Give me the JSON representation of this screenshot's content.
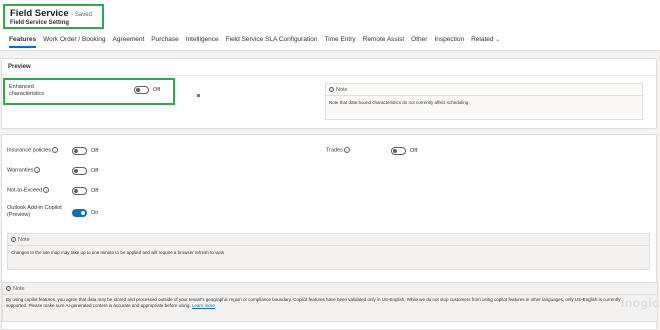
{
  "header": {
    "title": "Field Service",
    "saved": "- Saved",
    "subtitle": "Field Service Setting"
  },
  "tabs": [
    {
      "label": "Features"
    },
    {
      "label": "Work Order / Booking"
    },
    {
      "label": "Agreement"
    },
    {
      "label": "Purchase"
    },
    {
      "label": "Intelligence"
    },
    {
      "label": "Field Service SLA Configuration"
    },
    {
      "label": "Time Entry"
    },
    {
      "label": "Remote Assist"
    },
    {
      "label": "Other"
    },
    {
      "label": "Inspection"
    },
    {
      "label": "Related"
    }
  ],
  "preview": {
    "title": "Preview",
    "enhanced_label": "Enhanced\ncharacteristics",
    "enhanced_state": "Off",
    "note_header": "Note",
    "note_text": "Note that date bound characteristics do not currently affect scheduling."
  },
  "settings": {
    "insurance_label": "Insurance policies",
    "insurance_state": "Off",
    "warranties_label": "Warranties",
    "warranties_state": "Off",
    "nte_label": "Not-to-Exceed",
    "nte_state": "Off",
    "copilot_label": "Outlook Add-in Copilot\n(Preview)",
    "copilot_state": "On",
    "trades_label": "Trades",
    "trades_state": "Off"
  },
  "note_sitemap": {
    "header": "Note",
    "text": "Changes to the site map may take up to one minute to be applied and will require a browser refresh to view"
  },
  "note_copilot": {
    "header": "Note",
    "text": "By using copilot features, you agree that data may be stored and processed outside of your tenant's geographic region or compliance boundary. Copilot features have been validated only in US-English. While we do not stop customers from using copilot features in other languages, only US-English is currently supported. Please make sure AI-generated content is accurate and appropriate before using.",
    "link": "Learn more"
  },
  "watermark": "inogic",
  "colors": {
    "accent": "#0f6cbd",
    "highlight": "#2fa84f"
  }
}
